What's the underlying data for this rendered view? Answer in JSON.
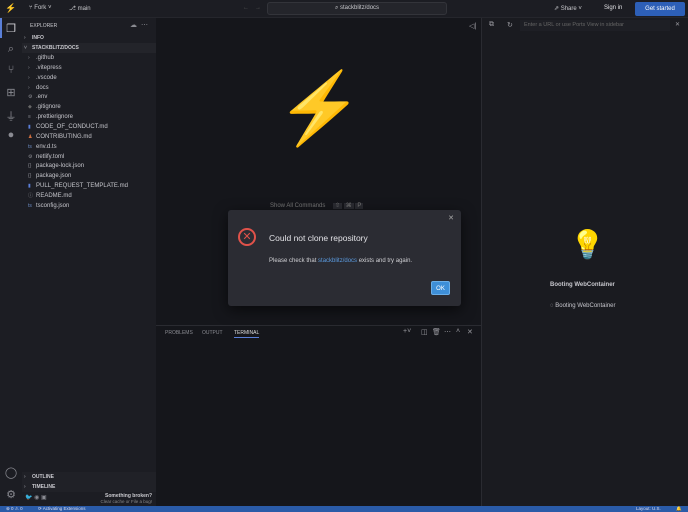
{
  "topbar": {
    "fork": "Fork",
    "branch": "main",
    "search": "stackblitz/docs",
    "share": "Share",
    "sign_in": "Sign in",
    "get_started": "Get started",
    "accent": "#2d5fb7"
  },
  "sidebar": {
    "title": "EXPLORER",
    "info": "INFO",
    "project": "STACKBLITZ/DOCS",
    "files": [
      {
        "name": ".github",
        "icon": "chevron-right"
      },
      {
        "name": ".vitepress",
        "icon": "chevron-right"
      },
      {
        "name": ".vscode",
        "icon": "chevron-right"
      },
      {
        "name": "docs",
        "icon": "chevron-right"
      },
      {
        "name": ".env",
        "icon": "gear"
      },
      {
        "name": ".gitignore",
        "icon": "git"
      },
      {
        "name": ".prettierignore",
        "icon": "lines"
      },
      {
        "name": "CODE_OF_CONDUCT.md",
        "icon": "markdown"
      },
      {
        "name": "CONTRIBUTING.md",
        "icon": "person"
      },
      {
        "name": "env.d.ts",
        "icon": "ts"
      },
      {
        "name": "netlify.toml",
        "icon": "gear"
      },
      {
        "name": "package-lock.json",
        "icon": "braces"
      },
      {
        "name": "package.json",
        "icon": "braces"
      },
      {
        "name": "PULL_REQUEST_TEMPLATE.md",
        "icon": "markdown"
      },
      {
        "name": "README.md",
        "icon": "info"
      },
      {
        "name": "tsconfig.json",
        "icon": "ts"
      }
    ],
    "outline": "OUTLINE",
    "timeline": "TIMELINE",
    "broken_title": "Something broken?",
    "broken_sub": "Clear cache or File a bug!"
  },
  "editor": {
    "show_all": "Show All Commands",
    "keys": [
      "⇧",
      "⌘",
      "P"
    ]
  },
  "dialog": {
    "title": "Could not clone repository",
    "msg_pre": "Please check that ",
    "msg_link": "stackblitz/docs",
    "msg_post": " exists and try again.",
    "ok": "OK"
  },
  "panel": {
    "tabs": [
      "PROBLEMS",
      "OUTPUT",
      "TERMINAL"
    ]
  },
  "preview": {
    "url_placeholder": "Enter a URL or use Ports View in sidebar",
    "booting_title": "Booting WebContainer",
    "booting_status": "Booting WebContainer"
  },
  "status": {
    "errors": "0",
    "warnings": "0",
    "activity": "Activating Extensions",
    "layout": "Layout: U.S."
  }
}
